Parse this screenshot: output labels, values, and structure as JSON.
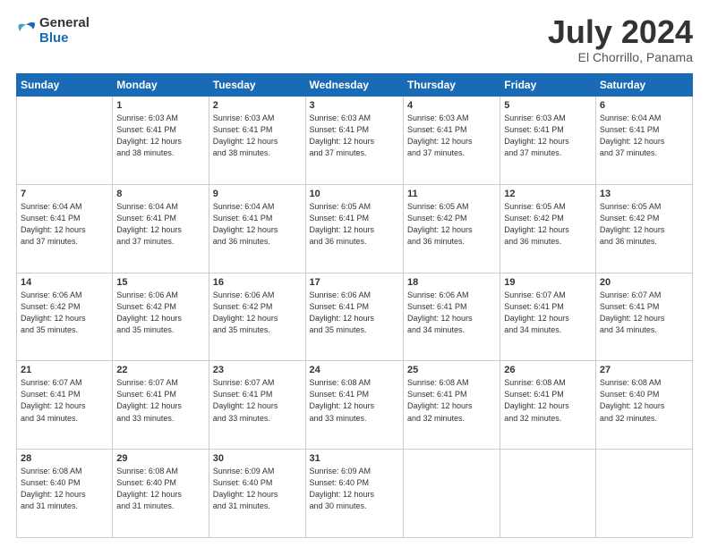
{
  "header": {
    "logo": {
      "general": "General",
      "blue": "Blue"
    },
    "title": "July 2024",
    "location": "El Chorrillo, Panama"
  },
  "weekdays": [
    "Sunday",
    "Monday",
    "Tuesday",
    "Wednesday",
    "Thursday",
    "Friday",
    "Saturday"
  ],
  "weeks": [
    [
      {
        "day": null,
        "info": null
      },
      {
        "day": "1",
        "info": "Sunrise: 6:03 AM\nSunset: 6:41 PM\nDaylight: 12 hours\nand 38 minutes."
      },
      {
        "day": "2",
        "info": "Sunrise: 6:03 AM\nSunset: 6:41 PM\nDaylight: 12 hours\nand 38 minutes."
      },
      {
        "day": "3",
        "info": "Sunrise: 6:03 AM\nSunset: 6:41 PM\nDaylight: 12 hours\nand 37 minutes."
      },
      {
        "day": "4",
        "info": "Sunrise: 6:03 AM\nSunset: 6:41 PM\nDaylight: 12 hours\nand 37 minutes."
      },
      {
        "day": "5",
        "info": "Sunrise: 6:03 AM\nSunset: 6:41 PM\nDaylight: 12 hours\nand 37 minutes."
      },
      {
        "day": "6",
        "info": "Sunrise: 6:04 AM\nSunset: 6:41 PM\nDaylight: 12 hours\nand 37 minutes."
      }
    ],
    [
      {
        "day": "7",
        "info": "Sunrise: 6:04 AM\nSunset: 6:41 PM\nDaylight: 12 hours\nand 37 minutes."
      },
      {
        "day": "8",
        "info": "Sunrise: 6:04 AM\nSunset: 6:41 PM\nDaylight: 12 hours\nand 37 minutes."
      },
      {
        "day": "9",
        "info": "Sunrise: 6:04 AM\nSunset: 6:41 PM\nDaylight: 12 hours\nand 36 minutes."
      },
      {
        "day": "10",
        "info": "Sunrise: 6:05 AM\nSunset: 6:41 PM\nDaylight: 12 hours\nand 36 minutes."
      },
      {
        "day": "11",
        "info": "Sunrise: 6:05 AM\nSunset: 6:42 PM\nDaylight: 12 hours\nand 36 minutes."
      },
      {
        "day": "12",
        "info": "Sunrise: 6:05 AM\nSunset: 6:42 PM\nDaylight: 12 hours\nand 36 minutes."
      },
      {
        "day": "13",
        "info": "Sunrise: 6:05 AM\nSunset: 6:42 PM\nDaylight: 12 hours\nand 36 minutes."
      }
    ],
    [
      {
        "day": "14",
        "info": "Sunrise: 6:06 AM\nSunset: 6:42 PM\nDaylight: 12 hours\nand 35 minutes."
      },
      {
        "day": "15",
        "info": "Sunrise: 6:06 AM\nSunset: 6:42 PM\nDaylight: 12 hours\nand 35 minutes."
      },
      {
        "day": "16",
        "info": "Sunrise: 6:06 AM\nSunset: 6:42 PM\nDaylight: 12 hours\nand 35 minutes."
      },
      {
        "day": "17",
        "info": "Sunrise: 6:06 AM\nSunset: 6:41 PM\nDaylight: 12 hours\nand 35 minutes."
      },
      {
        "day": "18",
        "info": "Sunrise: 6:06 AM\nSunset: 6:41 PM\nDaylight: 12 hours\nand 34 minutes."
      },
      {
        "day": "19",
        "info": "Sunrise: 6:07 AM\nSunset: 6:41 PM\nDaylight: 12 hours\nand 34 minutes."
      },
      {
        "day": "20",
        "info": "Sunrise: 6:07 AM\nSunset: 6:41 PM\nDaylight: 12 hours\nand 34 minutes."
      }
    ],
    [
      {
        "day": "21",
        "info": "Sunrise: 6:07 AM\nSunset: 6:41 PM\nDaylight: 12 hours\nand 34 minutes."
      },
      {
        "day": "22",
        "info": "Sunrise: 6:07 AM\nSunset: 6:41 PM\nDaylight: 12 hours\nand 33 minutes."
      },
      {
        "day": "23",
        "info": "Sunrise: 6:07 AM\nSunset: 6:41 PM\nDaylight: 12 hours\nand 33 minutes."
      },
      {
        "day": "24",
        "info": "Sunrise: 6:08 AM\nSunset: 6:41 PM\nDaylight: 12 hours\nand 33 minutes."
      },
      {
        "day": "25",
        "info": "Sunrise: 6:08 AM\nSunset: 6:41 PM\nDaylight: 12 hours\nand 32 minutes."
      },
      {
        "day": "26",
        "info": "Sunrise: 6:08 AM\nSunset: 6:41 PM\nDaylight: 12 hours\nand 32 minutes."
      },
      {
        "day": "27",
        "info": "Sunrise: 6:08 AM\nSunset: 6:40 PM\nDaylight: 12 hours\nand 32 minutes."
      }
    ],
    [
      {
        "day": "28",
        "info": "Sunrise: 6:08 AM\nSunset: 6:40 PM\nDaylight: 12 hours\nand 31 minutes."
      },
      {
        "day": "29",
        "info": "Sunrise: 6:08 AM\nSunset: 6:40 PM\nDaylight: 12 hours\nand 31 minutes."
      },
      {
        "day": "30",
        "info": "Sunrise: 6:09 AM\nSunset: 6:40 PM\nDaylight: 12 hours\nand 31 minutes."
      },
      {
        "day": "31",
        "info": "Sunrise: 6:09 AM\nSunset: 6:40 PM\nDaylight: 12 hours\nand 30 minutes."
      },
      {
        "day": null,
        "info": null
      },
      {
        "day": null,
        "info": null
      },
      {
        "day": null,
        "info": null
      }
    ]
  ]
}
